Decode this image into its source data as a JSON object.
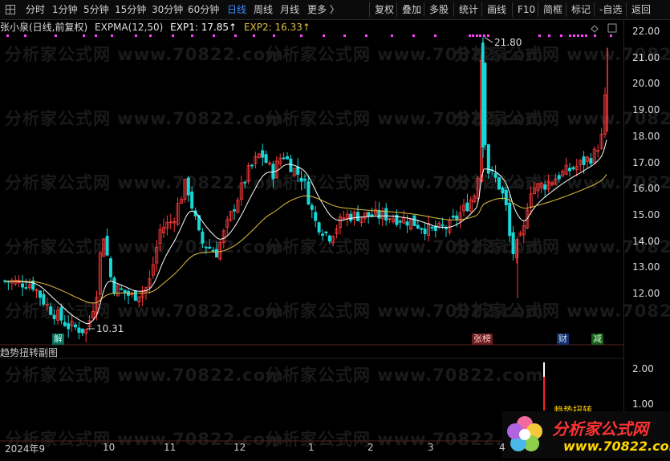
{
  "toolbar": {
    "left": [
      "分时",
      "1分钟",
      "5分钟",
      "15分钟",
      "30分钟",
      "60分钟",
      "日线",
      "周线",
      "月线",
      "更多 〉"
    ],
    "active": "日线",
    "right": [
      "复权",
      "叠加",
      "多股",
      "统计",
      "画线",
      "F10",
      "简框",
      "标记",
      "-自选",
      "返回"
    ]
  },
  "header": {
    "stock": "张小泉(日线,前复权)",
    "indicator": "EXPMA(12,50)",
    "exp1": "EXP1: 17.85↑",
    "exp2": "EXP2: 16.33↑"
  },
  "y_axis_main": [
    "22.00",
    "21.00",
    "20.00",
    "19.00",
    "18.00",
    "17.00",
    "16.00",
    "15.00",
    "14.00",
    "13.00",
    "12.00"
  ],
  "annotations": {
    "high": "21.80",
    "low": "10.31"
  },
  "event_tags": [
    "解",
    "张榜",
    "财",
    "减"
  ],
  "sub_chart": {
    "title": "趋势扭转副图",
    "y_axis": [
      "2.00",
      "1.00"
    ],
    "label": "趋势扭转"
  },
  "x_axis": [
    "2024年9",
    "10",
    "11",
    "12",
    "1",
    "2",
    "3",
    "4"
  ],
  "watermark": "分析家公式网 www.70822.com",
  "logo": {
    "name": "分析家公式网",
    "url": "www.70822.com"
  },
  "colors": {
    "up": "#ff3b3b",
    "down": "#17d6d6",
    "exp1": "#ffffff",
    "exp2": "#e0c040",
    "magenta": "#ff40ff"
  },
  "chart_data": {
    "type": "candlestick",
    "price_range": [
      11.8,
      22.0
    ],
    "high": 21.8,
    "low": 10.31,
    "exp1_last": 17.85,
    "exp2_last": 16.33
  }
}
